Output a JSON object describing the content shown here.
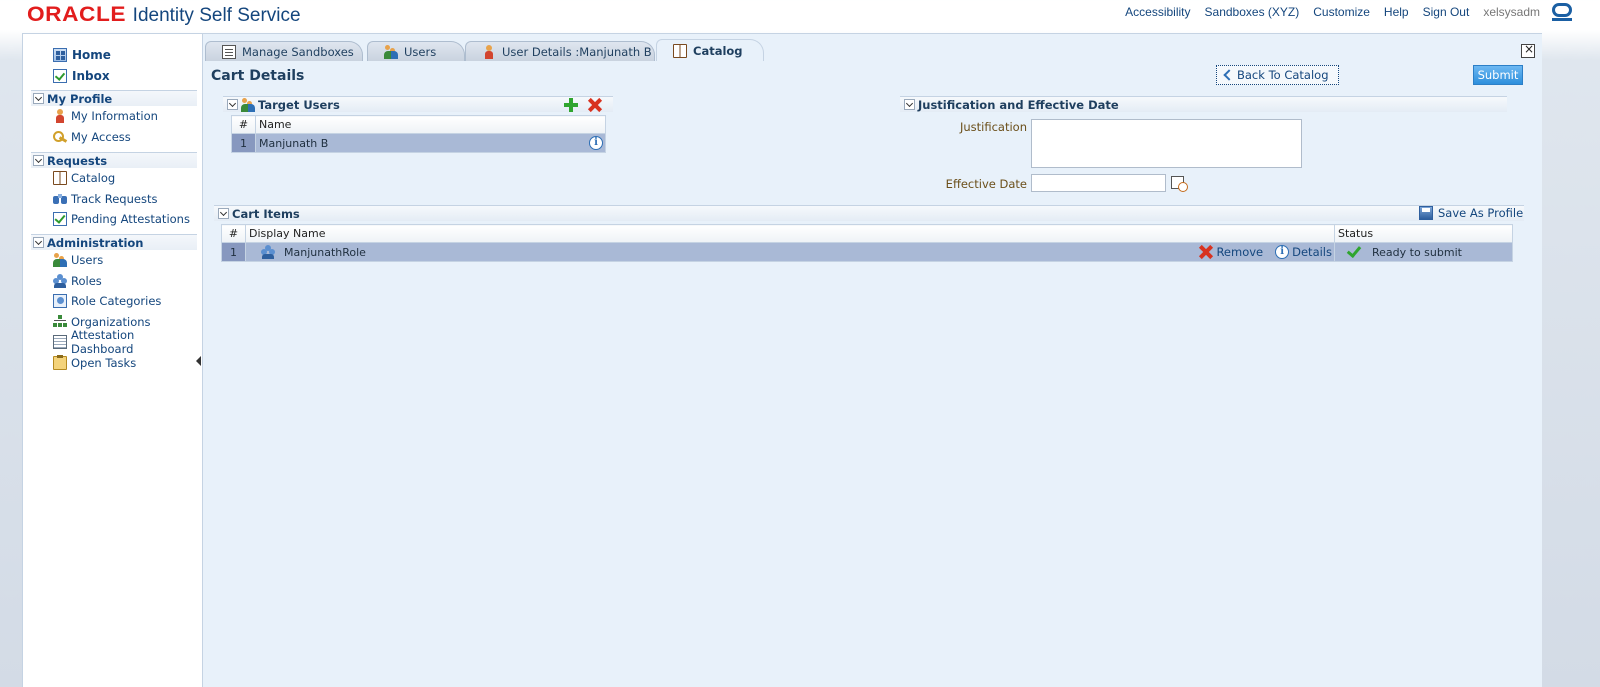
{
  "header": {
    "brand": "ORACLE",
    "product": "Identity Self Service",
    "links": [
      "Accessibility",
      "Sandboxes (XYZ)",
      "Customize",
      "Help",
      "Sign Out"
    ],
    "user": "xelsysadm"
  },
  "nav": {
    "home": "Home",
    "inbox": "Inbox",
    "sections": [
      {
        "title": "My Profile",
        "items": [
          "My Information",
          "My Access"
        ]
      },
      {
        "title": "Requests",
        "items": [
          "Catalog",
          "Track Requests",
          "Pending Attestations"
        ]
      },
      {
        "title": "Administration",
        "items": [
          "Users",
          "Roles",
          "Role Categories",
          "Organizations",
          "Attestation Dashboard",
          "Open Tasks"
        ]
      }
    ]
  },
  "tabs": [
    "Manage Sandboxes",
    "Users",
    "User Details :Manjunath B",
    "Catalog"
  ],
  "active_tab": "Catalog",
  "page": {
    "title": "Cart Details",
    "back_button": "Back To Catalog",
    "submit_button": "Submit"
  },
  "target_users": {
    "title": "Target Users",
    "columns": [
      "#",
      "Name"
    ],
    "rows": [
      {
        "num": "1",
        "name": "Manjunath B"
      }
    ]
  },
  "justification": {
    "title": "Justification and Effective Date",
    "justification_label": "Justification",
    "justification_value": "",
    "effective_date_label": "Effective Date",
    "effective_date_value": ""
  },
  "cart_items": {
    "title": "Cart Items",
    "save_profile": "Save As Profile",
    "columns": [
      "#",
      "Display Name",
      "Status"
    ],
    "rows": [
      {
        "num": "1",
        "name": "ManjunathRole",
        "remove": "Remove",
        "details": "Details",
        "status": "Ready to submit"
      }
    ]
  },
  "colors": {
    "brand_red": "#e21d1d",
    "link_blue": "#14467d",
    "submit_blue": "#2d8fdc",
    "selected_row": "#a9b9d6"
  }
}
